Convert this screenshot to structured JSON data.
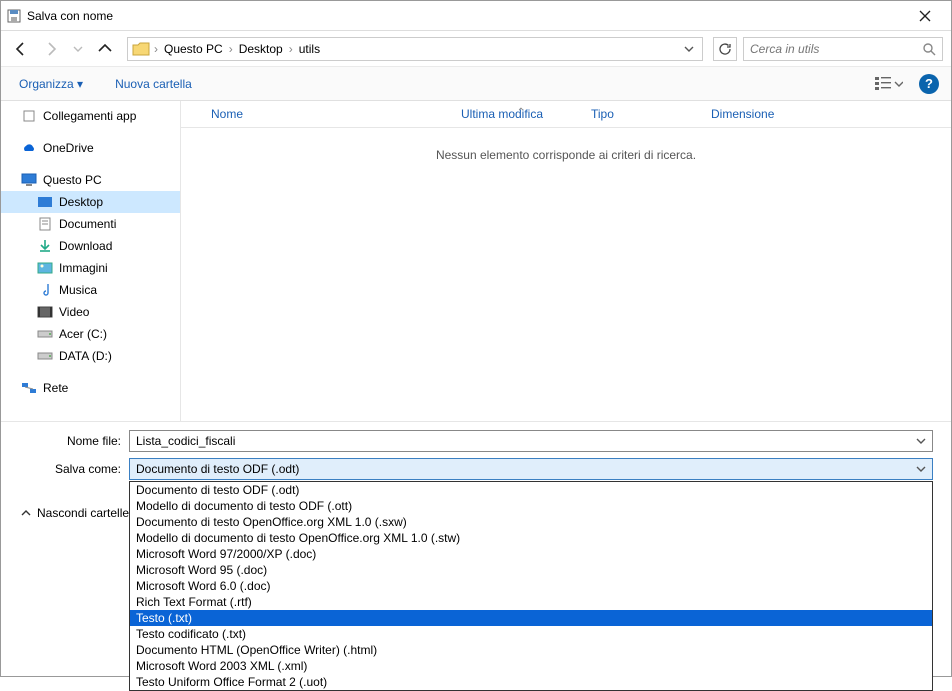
{
  "window": {
    "title": "Salva con nome"
  },
  "nav": {
    "crumbs": [
      "Questo PC",
      "Desktop",
      "utils"
    ]
  },
  "search": {
    "placeholder": "Cerca in utils"
  },
  "toolbar": {
    "organize": "Organizza",
    "new_folder": "Nuova cartella"
  },
  "sidebar": {
    "quick_access": "Collegamenti app",
    "onedrive": "OneDrive",
    "this_pc": "Questo PC",
    "desktop": "Desktop",
    "documents": "Documenti",
    "downloads": "Download",
    "pictures": "Immagini",
    "music": "Musica",
    "video": "Video",
    "drive_c": "Acer (C:)",
    "drive_d": "DATA (D:)",
    "network": "Rete"
  },
  "columns": {
    "name": "Nome",
    "modified": "Ultima modifica",
    "type": "Tipo",
    "size": "Dimensione"
  },
  "content": {
    "empty_msg": "Nessun elemento corrisponde ai criteri di ricerca."
  },
  "form": {
    "filename_label": "Nome file:",
    "filename_value": "Lista_codici_fiscali",
    "saveas_label": "Salva come:",
    "saveas_selected": "Documento di testo ODF (.odt)",
    "options": [
      "Documento di testo ODF (.odt)",
      "Modello di documento di testo ODF (.ott)",
      "Documento di testo OpenOffice.org XML 1.0 (.sxw)",
      "Modello di documento di testo OpenOffice.org XML 1.0 (.stw)",
      "Microsoft Word 97/2000/XP (.doc)",
      "Microsoft Word 95 (.doc)",
      "Microsoft Word 6.0 (.doc)",
      "Rich Text Format (.rtf)",
      "Testo (.txt)",
      "Testo codificato (.txt)",
      "Documento HTML (OpenOffice Writer) (.html)",
      "Microsoft Word 2003 XML (.xml)",
      "Testo Uniform Office Format 2 (.uot)"
    ],
    "highlighted_index": 8,
    "hide_folders": "Nascondi cartelle"
  }
}
